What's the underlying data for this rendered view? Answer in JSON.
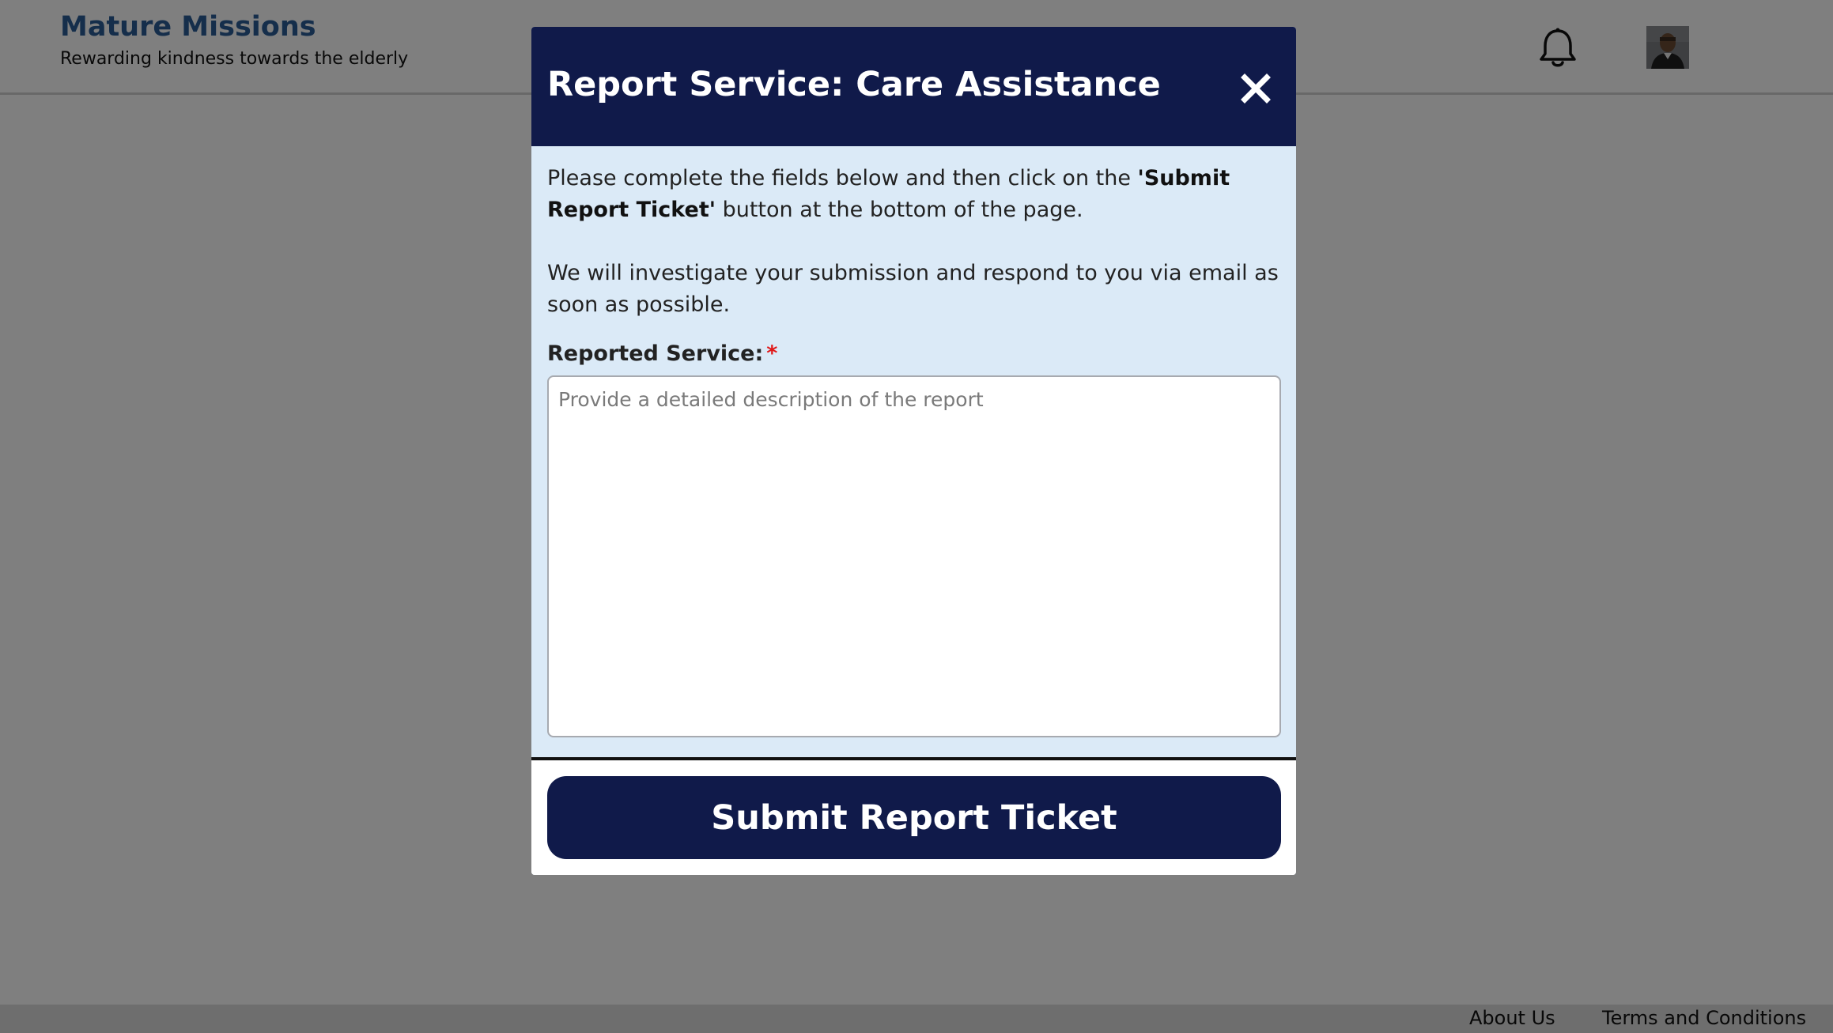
{
  "header": {
    "brand_title": "Mature Missions",
    "brand_tagline": "Rewarding kindness towards the elderly",
    "notification_icon": "bell-icon",
    "avatar_icon": "user-avatar"
  },
  "footer": {
    "about_label": "About Us",
    "terms_label": "Terms and Conditions"
  },
  "modal": {
    "title": "Report Service: Care Assistance",
    "close_icon": "close-icon",
    "intro_before": "Please complete the fields below and then click on the ",
    "intro_bold": "'Submit Report Ticket'",
    "intro_after": " button at the bottom of the page.",
    "followup": "We will investigate your submission and respond to you via email as soon as possible.",
    "field_label": "Reported Service:",
    "required_marker": "*",
    "textarea_placeholder": "Provide a detailed description of the report",
    "textarea_value": "",
    "submit_label": "Submit Report Ticket"
  },
  "colors": {
    "brand": "#2a5d96",
    "modal_header": "#101a4a",
    "modal_body": "#dbeaf7",
    "required": "#e01818"
  }
}
